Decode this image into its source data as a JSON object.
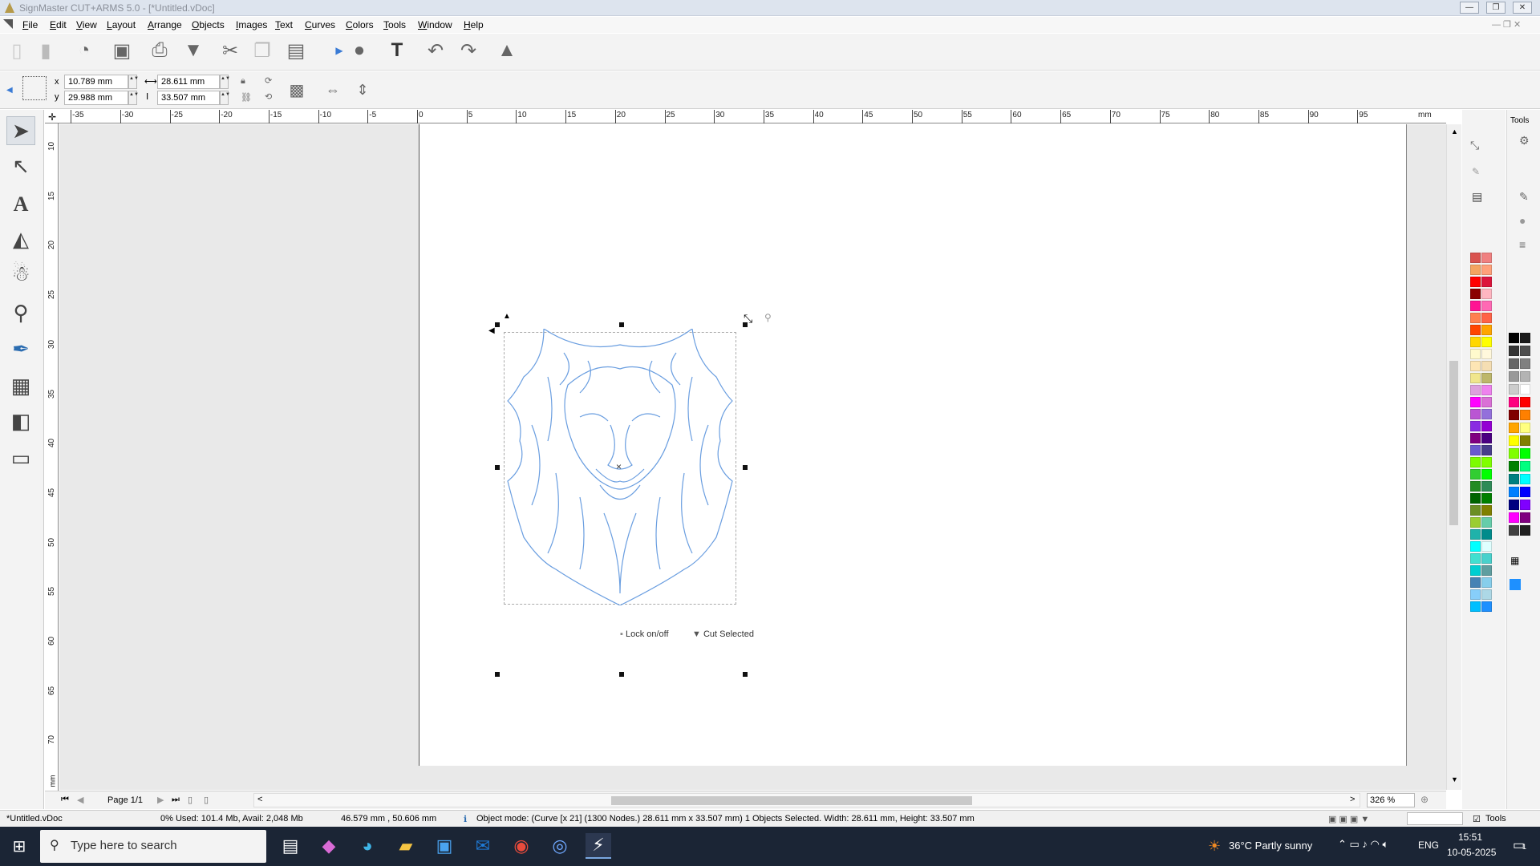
{
  "window": {
    "title": "SignMaster CUT+ARMS 5.0 - [*Untitled.vDoc]",
    "controls": {
      "minimize": "—",
      "restore": "❐",
      "close": "✕"
    }
  },
  "menu": [
    "File",
    "Edit",
    "View",
    "Layout",
    "Arrange",
    "Objects",
    "Images",
    "Text",
    "Curves",
    "Colors",
    "Tools",
    "Window",
    "Help"
  ],
  "properties": {
    "x_label": "x",
    "x_value": "10.789 mm",
    "y_label": "y",
    "y_value": "29.988 mm",
    "width_value": "28.611 mm",
    "height_value": "33.507 mm"
  },
  "ruler": {
    "unit": "mm",
    "h_labels": [
      "-35",
      "-30",
      "-25",
      "-20",
      "-15",
      "-10",
      "-5",
      "0",
      "5",
      "10",
      "15",
      "20",
      "25",
      "30",
      "35",
      "40",
      "45",
      "50",
      "55",
      "60",
      "65",
      "70",
      "75",
      "80",
      "85",
      "90",
      "95"
    ],
    "v_labels": [
      "10",
      "15",
      "20",
      "25",
      "30",
      "35",
      "40",
      "45",
      "50",
      "55",
      "60",
      "65",
      "70"
    ],
    "v_unit": "mm"
  },
  "canvas": {
    "lock_label": "Lock on/off",
    "cut_label": "Cut Selected",
    "artwork_color": "#6a9ee0"
  },
  "page_nav": {
    "label": "Page 1/1",
    "zoom": "326 %"
  },
  "status": {
    "doc_name": "*Untitled.vDoc",
    "memory": "0%   Used: 101.4 Mb, Avail: 2,048 Mb",
    "coords": "46.579 mm , 50.606 mm",
    "object_info": "Object mode: (Curve [x 21] (1300 Nodes.) 28.611 mm x 33.507 mm)  1 Objects Selected.  Width: 28.611 mm, Height: 33.507 mm",
    "tools_label": "Tools"
  },
  "right_panel": {
    "title": "Tools"
  },
  "palette_left": [
    "#d9534f",
    "#f08080",
    "#f4a460",
    "#ffa07a",
    "#ff0000",
    "#dc143c",
    "#8b0000",
    "#ffb6c1",
    "#ff1493",
    "#ff69b4",
    "#ff7f50",
    "#ff6347",
    "#ff4500",
    "#ffa500",
    "#ffd700",
    "#ffff00",
    "#fffacd",
    "#fff8dc",
    "#fde5b4",
    "#f5deb3",
    "#f0e68c",
    "#bdb76b",
    "#dda0dd",
    "#ee82ee",
    "#ff00ff",
    "#da70d6",
    "#ba55d3",
    "#9370db",
    "#8a2be2",
    "#9400d3",
    "#800080",
    "#4b0082",
    "#6a5acd",
    "#483d8b",
    "#7cfc00",
    "#7fff00",
    "#32cd32",
    "#00ff00",
    "#228b22",
    "#2e8b57",
    "#006400",
    "#008000",
    "#6b8e23",
    "#808000",
    "#9acd32",
    "#66cdaa",
    "#20b2aa",
    "#008b8b",
    "#00ffff",
    "#e0ffff",
    "#40e0d0",
    "#48d1cc",
    "#00ced1",
    "#5f9ea0",
    "#4682b4",
    "#87ceeb",
    "#87cefa",
    "#add8e6",
    "#00bfff",
    "#1e90ff"
  ],
  "palette_right": [
    "#000000",
    "#1a1a1a",
    "#333333",
    "#4d4d4d",
    "#666666",
    "#808080",
    "#999999",
    "#b3b3b3",
    "#cccccc",
    "#ffffff",
    "#ff0080",
    "#ff0000",
    "#800000",
    "#ff8000",
    "#ffa500",
    "#ffff80",
    "#ffff00",
    "#808000",
    "#80ff00",
    "#00ff00",
    "#008000",
    "#00ff80",
    "#008080",
    "#00ffff",
    "#0080ff",
    "#0000ff",
    "#000080",
    "#8000ff",
    "#ff00ff",
    "#800080",
    "#404040",
    "#202020"
  ],
  "taskbar": {
    "search_placeholder": "Type here to search",
    "weather": "36°C  Partly sunny",
    "lang": "ENG",
    "time": "15:51",
    "date": "10-05-2025",
    "notification_count": "1"
  }
}
